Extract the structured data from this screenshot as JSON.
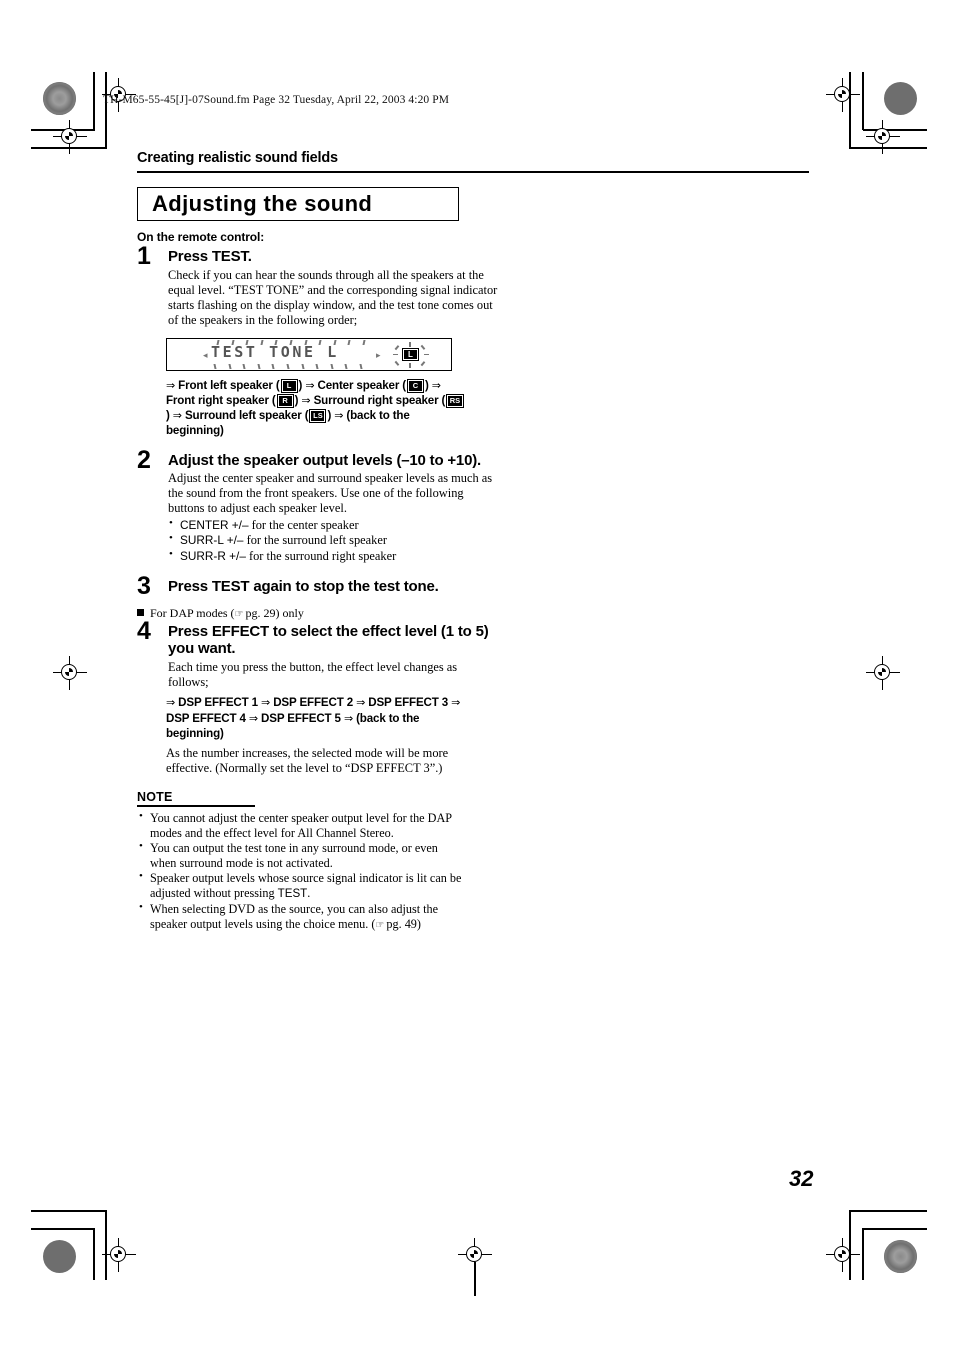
{
  "file_header": "TH-M65-55-45[J]-07Sound.fm  Page 32  Tuesday, April 22, 2003  4:20 PM",
  "running_head": "Creating realistic sound fields",
  "section_title": "Adjusting the sound",
  "sub_label": "On the remote control:",
  "steps": [
    {
      "number": "1",
      "title": "Press TEST.",
      "body": "Check if you can hear the sounds through all the speakers at the equal level. “TEST TONE” and the corresponding signal indicator starts flashing on the display window, and the test tone comes out of the speakers in the following order;"
    },
    {
      "number": "2",
      "title": "Adjust the speaker output levels (–10 to +10).",
      "body": "Adjust the center speaker and surround speaker levels as much as the sound from the front speakers. Use one of the following buttons to adjust each speaker level.",
      "bullets": [
        {
          "button": "CENTER +/–",
          "text": " for the center speaker"
        },
        {
          "button": "SURR-L +/–",
          "text": " for the surround left speaker"
        },
        {
          "button": "SURR-R +/–",
          "text": " for the surround right speaker"
        }
      ]
    },
    {
      "number": "3",
      "title": "Press TEST again to stop the test tone."
    },
    {
      "number": "4",
      "title": "Press EFFECT to select the effect level (1 to 5) you want.",
      "body": "Each time you press the button, the effect level changes as follows;",
      "footnote": "As the number increases, the selected mode will be more effective. (Normally set the level to “DSP EFFECT 3”.)"
    }
  ],
  "display": {
    "lcd_text": "TEST TONE L",
    "indicator_label": "L"
  },
  "speaker_flow": {
    "arrow": "⇒",
    "items": [
      {
        "label": "Front left speaker",
        "badge": "L"
      },
      {
        "label": "Center speaker",
        "badge": "C"
      },
      {
        "label": "Front right speaker",
        "badge": "R"
      },
      {
        "label": "Surround right speaker",
        "badge": "RS"
      },
      {
        "label": "Surround left speaker",
        "badge": "LS"
      }
    ],
    "loop_text": "(back to the beginning)"
  },
  "dap_line": {
    "prefix": "For DAP modes (",
    "pointer": "☞",
    "reference": "pg. 29",
    "suffix": ") only"
  },
  "effect_flow": {
    "arrow": "⇒",
    "items": [
      "DSP EFFECT 1",
      "DSP EFFECT 2",
      "DSP EFFECT 3",
      "DSP EFFECT 4",
      "DSP EFFECT 5"
    ],
    "loop_text": "(back to the beginning)"
  },
  "note": {
    "title": "NOTE",
    "items": [
      {
        "text": "You cannot adjust the center speaker output level for the DAP modes and the effect level for All Channel Stereo."
      },
      {
        "text": "You can output the test tone in any surround mode, or even when surround mode is not activated."
      },
      {
        "text_before": "Speaker output levels whose source signal indicator is lit can be adjusted without pressing ",
        "emphasis": "TEST",
        "text_after": "."
      },
      {
        "text_before": "When selecting DVD as the source, you can also adjust the speaker output levels using the choice menu. (",
        "pointer": "☞",
        "reference": "pg. 49",
        "text_after": ")"
      }
    ]
  },
  "page_number": "32"
}
